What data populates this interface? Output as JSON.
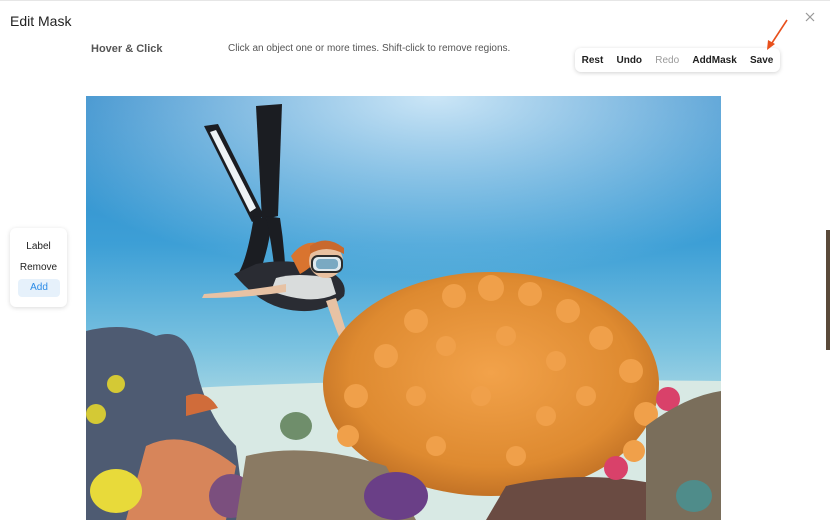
{
  "window": {
    "title": "Edit Mask"
  },
  "header": {
    "mode_label": "Hover & Click",
    "hint": "Click an object one or more times. Shift-click to remove regions."
  },
  "toolbar": {
    "reset_label": "Rest",
    "undo_label": "Undo",
    "redo_label": "Redo",
    "add_mask_label": "AddMask",
    "save_label": "Save"
  },
  "side_panel": {
    "label_label": "Label",
    "remove_label": "Remove",
    "add_label": "Add"
  },
  "image": {
    "subject": "diver-with-coral-photo"
  },
  "colors": {
    "accent": "#2b8be6",
    "arrow": "#e8501c",
    "add_bg": "#e6f1fb"
  },
  "icons": {
    "close": "close-icon",
    "annotation": "arrow-annotation-icon"
  }
}
